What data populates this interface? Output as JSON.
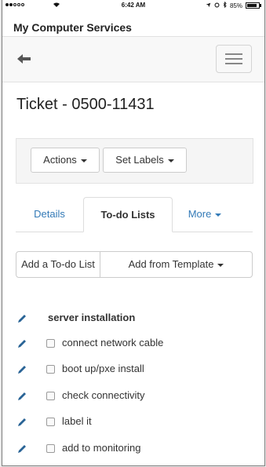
{
  "status_bar": {
    "time": "6:42 AM",
    "battery_text": "85%",
    "battery_level": 0.85,
    "signal_icon": "signal-dots-icon",
    "wifi_icon": "wifi-icon",
    "location_icon": "location-arrow-icon",
    "alarm_icon": "alarm-icon",
    "bluetooth_icon": "bluetooth-icon"
  },
  "app": {
    "title": "My Computer Services"
  },
  "navbar": {
    "back_icon": "back-arrow-icon",
    "menu_icon": "hamburger-menu-icon"
  },
  "ticket": {
    "title": "Ticket - 0500-11431"
  },
  "toolbar": {
    "actions_label": "Actions",
    "set_labels_label": "Set Labels"
  },
  "tabs": [
    {
      "label": "Details",
      "active": false
    },
    {
      "label": "To-do Lists",
      "active": true
    },
    {
      "label": "More",
      "active": false
    }
  ],
  "todo_buttons": {
    "add_list_label": "Add a To-do List",
    "add_template_label": "Add from Template"
  },
  "todo_list": {
    "name": "server installation",
    "items": [
      {
        "label": "connect network cable",
        "checked": false
      },
      {
        "label": "boot up/pxe install",
        "checked": false
      },
      {
        "label": "check connectivity",
        "checked": false
      },
      {
        "label": "label it",
        "checked": false
      },
      {
        "label": "add to monitoring",
        "checked": false
      }
    ]
  },
  "colors": {
    "link_blue": "#337ab7",
    "pencil_blue": "#2a6496",
    "panel_gray": "#f5f5f5",
    "navbar_gray": "#f8f8f8"
  }
}
